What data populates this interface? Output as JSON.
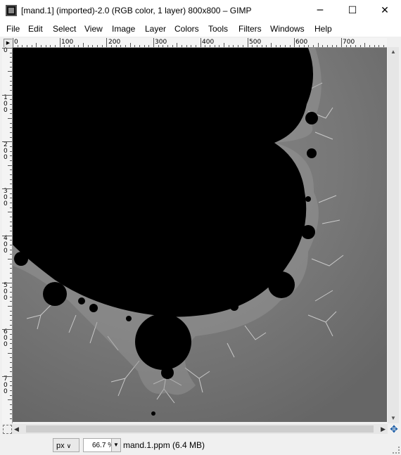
{
  "window": {
    "title": "[mand.1] (imported)-2.0 (RGB color, 1 layer) 800x800 – GIMP",
    "app_icon": "gimp-image-icon",
    "controls": [
      "minimize-icon",
      "maximize-icon",
      "close-icon"
    ]
  },
  "menu": {
    "items": [
      "File",
      "Edit",
      "Select",
      "View",
      "Image",
      "Layer",
      "Colors",
      "Tools",
      "Filters",
      "Windows",
      "Help"
    ]
  },
  "rulers": {
    "horizontal_labels": [
      "0",
      "100",
      "200",
      "300",
      "400",
      "500",
      "600",
      "700"
    ],
    "vertical_labels": [
      "0",
      "100",
      "200",
      "300",
      "400",
      "500",
      "600",
      "700"
    ]
  },
  "canvas": {
    "content": "mandelbrot-set",
    "colors": {
      "set": "#000000",
      "background": "#6f6f6f",
      "highlight": "#8a8a8a",
      "filaments": "#d8d8d8"
    }
  },
  "statusbar": {
    "unit": "px",
    "zoom": "66.7 %",
    "info": "mand.1.ppm (6.4 MB)"
  },
  "colors": {
    "titlebar": "#ffffff",
    "chrome": "#f0f0f0",
    "ruler": "#f4f4f4",
    "navigate_accent": "#1c5ea8"
  }
}
